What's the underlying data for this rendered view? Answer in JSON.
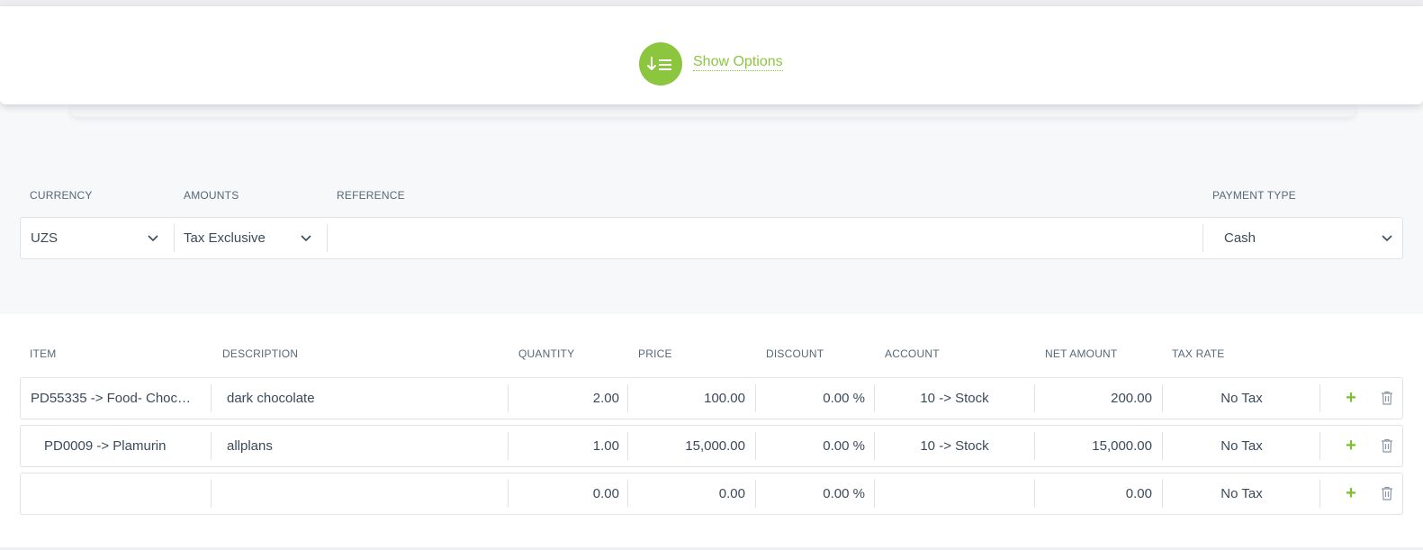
{
  "options": {
    "show_label": "Show Options",
    "icon": "sort-list-icon",
    "accent": "#8cc63f"
  },
  "header_fields": {
    "labels": {
      "currency": "CURRENCY",
      "amounts": "AMOUNTS",
      "reference": "REFERENCE",
      "payment_type": "PAYMENT TYPE"
    },
    "currency": "UZS",
    "amounts": "Tax Exclusive",
    "reference": "",
    "payment_type": "Cash"
  },
  "lines": {
    "headers": {
      "item": "ITEM",
      "description": "DESCRIPTION",
      "quantity": "QUANTITY",
      "price": "PRICE",
      "discount": "DISCOUNT",
      "account": "ACCOUNT",
      "net_amount": "NET AMOUNT",
      "tax_rate": "TAX RATE"
    },
    "rows": [
      {
        "item": "PD55335 -> Food- Choc…",
        "description": "dark chocolate",
        "quantity": "2.00",
        "price": "100.00",
        "discount": "0.00 %",
        "account": "10 -> Stock",
        "net_amount": "200.00",
        "tax_rate": "No Tax",
        "add": "+"
      },
      {
        "item": "PD0009 -> Plamurin",
        "description": "allplans",
        "quantity": "1.00",
        "price": "15,000.00",
        "discount": "0.00 %",
        "account": "10 -> Stock",
        "net_amount": "15,000.00",
        "tax_rate": "No Tax",
        "add": "+"
      },
      {
        "item": "",
        "description": "",
        "quantity": "0.00",
        "price": "0.00",
        "discount": "0.00 %",
        "account": "",
        "net_amount": "0.00",
        "tax_rate": "No Tax",
        "add": "+"
      }
    ]
  },
  "colors": {
    "accent": "#8cc63f",
    "text": "#3b4a5a",
    "label": "#56687a",
    "border": "#dfe3e8"
  }
}
